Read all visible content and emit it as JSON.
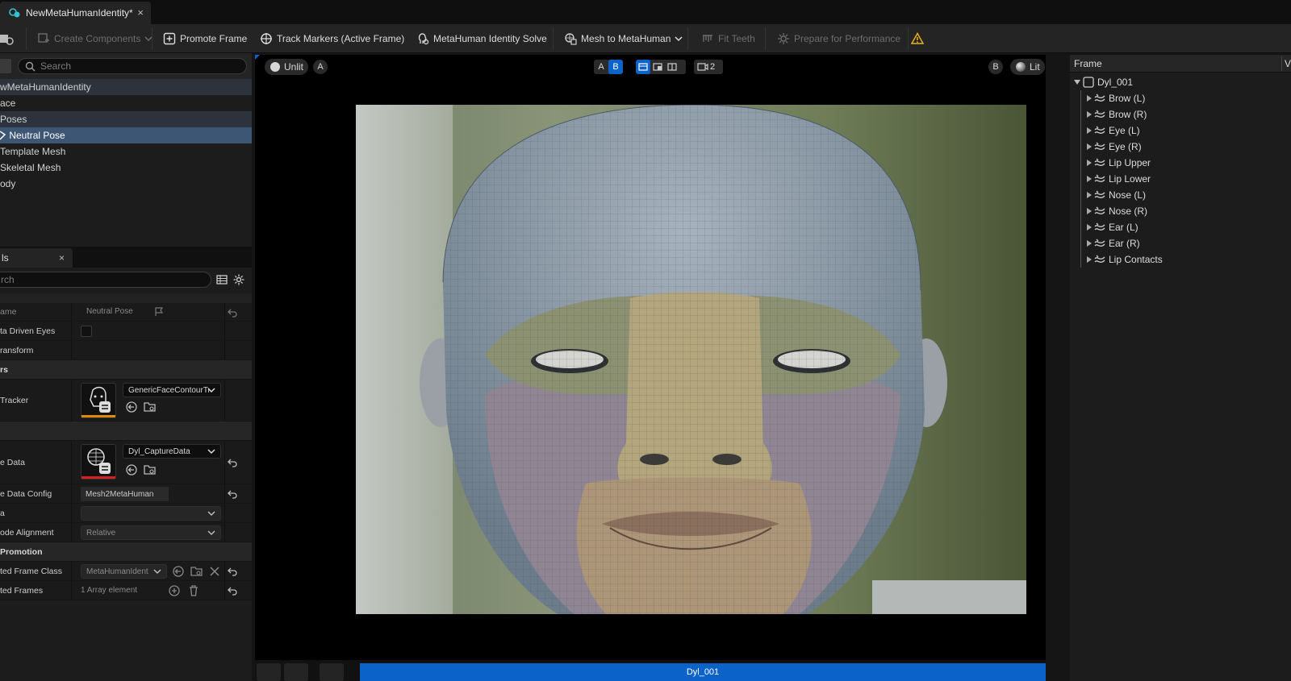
{
  "tab": {
    "title": "NewMetaHumanIdentity*",
    "close": "×"
  },
  "toolbar": {
    "create_components": "Create Components",
    "promote_frame": "Promote Frame",
    "track_markers": "Track Markers (Active Frame)",
    "identity_solve": "MetaHuman Identity Solve",
    "mesh_to_metahuman": "Mesh to MetaHuman",
    "fit_teeth": "Fit Teeth",
    "prepare_performance": "Prepare for Performance"
  },
  "outliner": {
    "search_placeholder": "Search",
    "items": [
      {
        "label": "wMetaHumanIdentity"
      },
      {
        "label": "ace"
      },
      {
        "label": "Poses"
      },
      {
        "label": "Neutral Pose"
      },
      {
        "label": "Template Mesh"
      },
      {
        "label": "Skeletal Mesh"
      },
      {
        "label": "ody"
      }
    ]
  },
  "details": {
    "tab_label": "ls",
    "tab_close": "×",
    "search_placeholder": "rch",
    "rows": {
      "name_label": "ame",
      "name_value": "Neutral Pose",
      "eyes_label": "ta Driven Eyes",
      "transform_label": "ransform",
      "trackers_cat": "rs",
      "tracker_label": " Tracker",
      "tracker_value": "GenericFaceContourTracker",
      "capture_label": "e Data",
      "capture_value": "Dyl_CaptureData",
      "capture_config_label": "e Data Config",
      "capture_config_value": "Mesh2MetaHuman",
      "a_label": "a",
      "mode_label": "ode Alignment",
      "mode_value": "Relative",
      "promotion_cat": " Promotion",
      "frame_class_label": "ted Frame Class",
      "frame_class_value": "MetaHumanIdent",
      "frames_label": "ted Frames",
      "frames_value": "1 Array element"
    }
  },
  "viewport": {
    "unlit": "Unlit",
    "a_left": "A",
    "ab_a": "A",
    "ab_b": "B",
    "layout_count": "2",
    "b_right": "B",
    "lit": "Lit",
    "bottom_label": "Dyl_001"
  },
  "frame_panel": {
    "header": "Frame",
    "header_v": "V",
    "root": "Dyl_001",
    "items": [
      {
        "label": "Brow (L)"
      },
      {
        "label": "Brow (R)"
      },
      {
        "label": "Eye (L)"
      },
      {
        "label": "Eye (R)"
      },
      {
        "label": "Lip Upper"
      },
      {
        "label": "Lip Lower"
      },
      {
        "label": "Nose (L)"
      },
      {
        "label": "Nose (R)"
      },
      {
        "label": "Ear (L)"
      },
      {
        "label": "Ear (R)"
      },
      {
        "label": "Lip Contacts"
      }
    ]
  },
  "colors": {
    "accent": "#0b62c9",
    "selected_row": "#3d5674",
    "warning": "#e8b018",
    "tracker_bar": "#e08a00",
    "capture_bar": "#d52020"
  }
}
